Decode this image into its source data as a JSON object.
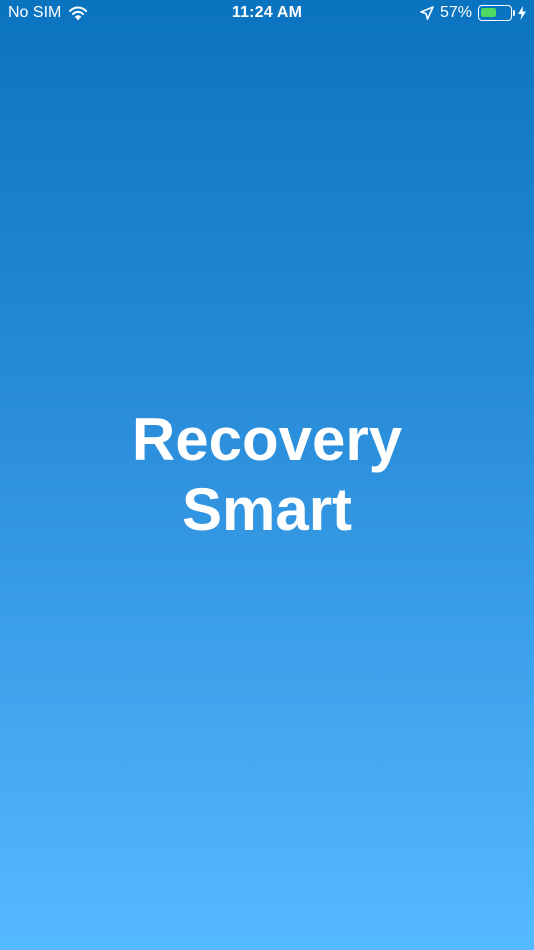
{
  "status_bar": {
    "carrier": "No SIM",
    "time": "11:24 AM",
    "battery_percent_label": "57%",
    "battery_level": 0.57,
    "icons": [
      "wifi-icon",
      "location-arrow-icon",
      "battery-icon",
      "charging-bolt-icon"
    ]
  },
  "splash": {
    "title_line1": "Recovery",
    "title_line2": "Smart"
  },
  "colors": {
    "gradient_top": "#0a73bf",
    "gradient_bottom": "#55baff",
    "text": "#ffffff",
    "battery_fill": "#4cd964"
  }
}
